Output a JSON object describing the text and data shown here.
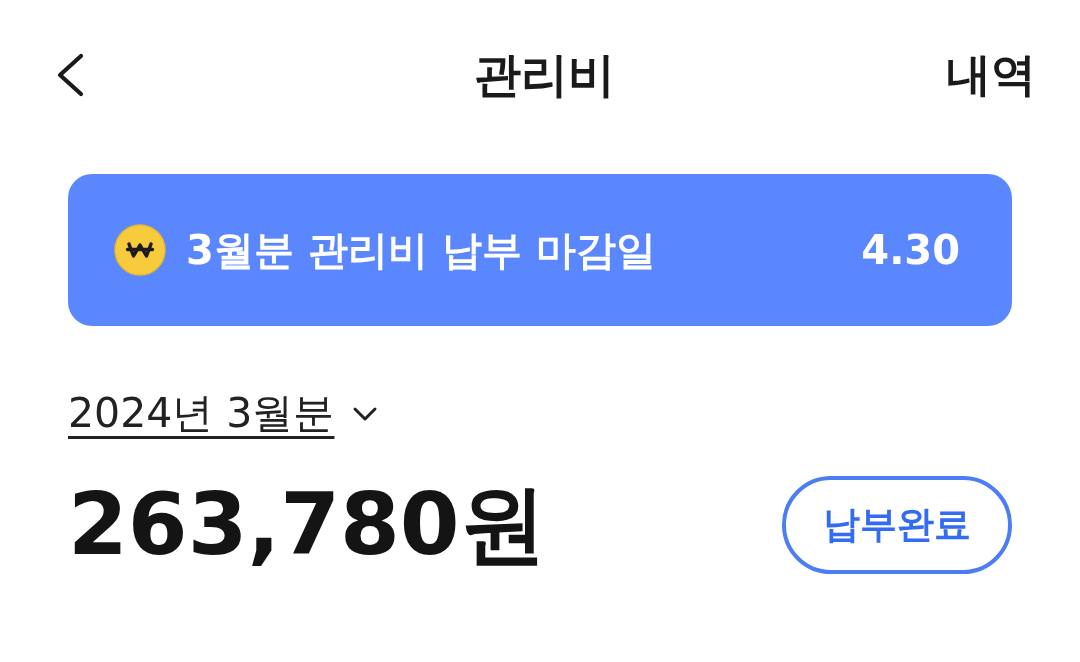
{
  "header": {
    "title": "관리비",
    "action": "내역"
  },
  "banner": {
    "text": "3월분 관리비 납부 마감일",
    "date": "4.30"
  },
  "bill": {
    "period": "2024년 3월분",
    "amount": "263,780원",
    "status": "납부완료"
  }
}
